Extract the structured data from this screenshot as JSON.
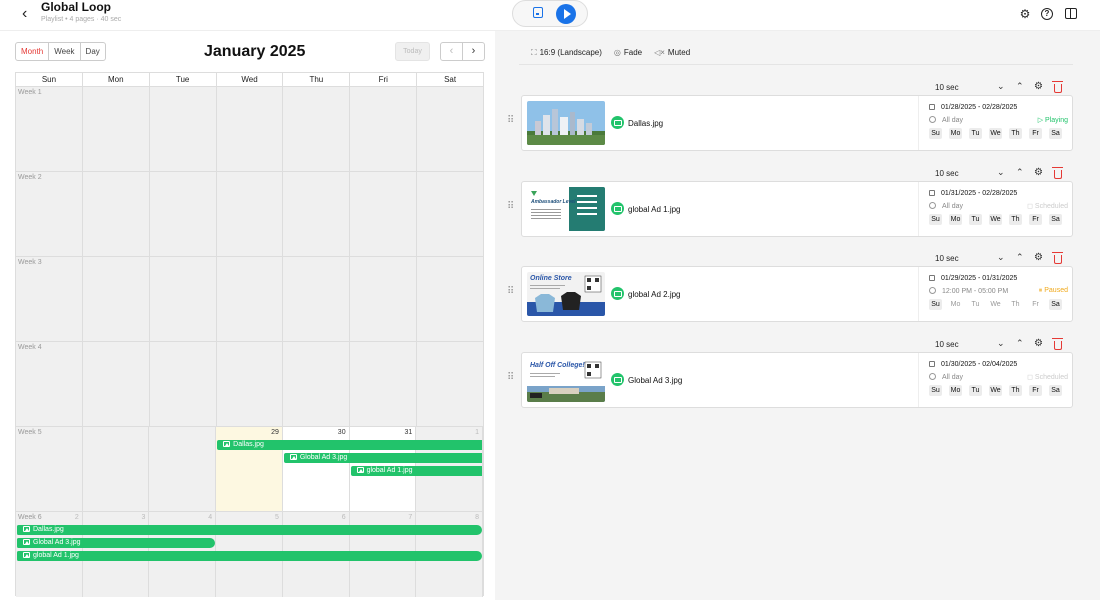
{
  "header": {
    "title": "Global Loop",
    "subtitle": "Playlist • 4 pages · 40 sec",
    "back_icon": "chevron-left-icon",
    "actions": [
      "save-icon",
      "play-icon"
    ],
    "right_icons": [
      "gear-icon",
      "help-icon",
      "layout-icon"
    ]
  },
  "calendar": {
    "views": [
      "Month",
      "Week",
      "Day"
    ],
    "active_view": "Month",
    "title": "January 2025",
    "today_label": "Today",
    "weekdays": [
      "Sun",
      "Mon",
      "Tue",
      "Wed",
      "Thu",
      "Fri",
      "Sat"
    ],
    "weeks": [
      {
        "label": "Week 1",
        "days": [
          {
            "d": "",
            "s": "blank"
          },
          {
            "d": "",
            "s": "blank"
          },
          {
            "d": "",
            "s": "blank"
          },
          {
            "d": "",
            "s": "blank"
          },
          {
            "d": "",
            "s": "blank"
          },
          {
            "d": "",
            "s": "blank"
          },
          {
            "d": "",
            "s": "blank"
          }
        ]
      },
      {
        "label": "Week 2",
        "days": [
          {
            "d": "",
            "s": "blank"
          },
          {
            "d": "",
            "s": "blank"
          },
          {
            "d": "",
            "s": "blank"
          },
          {
            "d": "",
            "s": "blank"
          },
          {
            "d": "",
            "s": "blank"
          },
          {
            "d": "",
            "s": "blank"
          },
          {
            "d": "",
            "s": "blank"
          }
        ]
      },
      {
        "label": "Week 3",
        "days": [
          {
            "d": "",
            "s": "blank"
          },
          {
            "d": "",
            "s": "blank"
          },
          {
            "d": "",
            "s": "blank"
          },
          {
            "d": "",
            "s": "blank"
          },
          {
            "d": "",
            "s": "blank"
          },
          {
            "d": "",
            "s": "blank"
          },
          {
            "d": "",
            "s": "blank"
          }
        ]
      },
      {
        "label": "Week 4",
        "days": [
          {
            "d": "",
            "s": "blank"
          },
          {
            "d": "",
            "s": "blank"
          },
          {
            "d": "",
            "s": "blank"
          },
          {
            "d": "",
            "s": "blank"
          },
          {
            "d": "",
            "s": "blank"
          },
          {
            "d": "",
            "s": "blank"
          },
          {
            "d": "",
            "s": "blank"
          }
        ]
      },
      {
        "label": "Week 5",
        "days": [
          {
            "d": "",
            "s": "blank"
          },
          {
            "d": "",
            "s": "blank"
          },
          {
            "d": "",
            "s": "blank"
          },
          {
            "d": "29",
            "s": "today"
          },
          {
            "d": "30",
            "s": "cur"
          },
          {
            "d": "31",
            "s": "cur"
          },
          {
            "d": "1",
            "s": "other"
          }
        ]
      },
      {
        "label": "Week 6",
        "days": [
          {
            "d": "2",
            "s": "other"
          },
          {
            "d": "3",
            "s": "other"
          },
          {
            "d": "4",
            "s": "other"
          },
          {
            "d": "5",
            "s": "other"
          },
          {
            "d": "6",
            "s": "other"
          },
          {
            "d": "7",
            "s": "other"
          },
          {
            "d": "8",
            "s": "other"
          }
        ]
      }
    ],
    "events": [
      {
        "week": 4,
        "start": 3,
        "end": 7,
        "lane": 0,
        "label": "Dallas.jpg"
      },
      {
        "week": 4,
        "start": 4,
        "end": 7,
        "lane": 1,
        "label": "Global Ad 3.jpg"
      },
      {
        "week": 4,
        "start": 5,
        "end": 7,
        "lane": 2,
        "label": "global Ad 1.jpg"
      },
      {
        "week": 5,
        "start": 0,
        "end": 7,
        "lane": 0,
        "label": "Dallas.jpg",
        "round_end": true
      },
      {
        "week": 5,
        "start": 0,
        "end": 3,
        "lane": 1,
        "label": "Global Ad 3.jpg",
        "round_end": true
      },
      {
        "week": 5,
        "start": 0,
        "end": 7,
        "lane": 2,
        "label": "global Ad 1.jpg",
        "round_end": true
      }
    ]
  },
  "options": {
    "aspect": "16:9 (Landscape)",
    "transition": "Fade",
    "audio": "Muted"
  },
  "playlist": [
    {
      "duration": "10 sec",
      "file": "Dallas.jpg",
      "dates": "01/28/2025 - 02/28/2025",
      "time": "All day",
      "status": "Playing",
      "status_kind": "playing",
      "days": [
        [
          "Su",
          true
        ],
        [
          "Mo",
          true
        ],
        [
          "Tu",
          true
        ],
        [
          "We",
          true
        ],
        [
          "Th",
          true
        ],
        [
          "Fr",
          true
        ],
        [
          "Sa",
          true
        ]
      ],
      "thumb": "city"
    },
    {
      "duration": "10 sec",
      "file": "global Ad 1.jpg",
      "dates": "01/31/2025 - 02/28/2025",
      "time": "All day",
      "status": "Scheduled",
      "status_kind": "scheduled",
      "days": [
        [
          "Su",
          true
        ],
        [
          "Mo",
          true
        ],
        [
          "Tu",
          true
        ],
        [
          "We",
          true
        ],
        [
          "Th",
          true
        ],
        [
          "Fr",
          true
        ],
        [
          "Sa",
          true
        ]
      ],
      "thumb": "ambassador",
      "thumb_text": "Ambassador Level"
    },
    {
      "duration": "10 sec",
      "file": "global Ad 2.jpg",
      "dates": "01/29/2025 - 01/31/2025",
      "time": "12:00 PM - 05:00 PM",
      "status": "Paused",
      "status_kind": "paused",
      "days": [
        [
          "Su",
          true
        ],
        [
          "Mo",
          false
        ],
        [
          "Tu",
          false
        ],
        [
          "We",
          false
        ],
        [
          "Th",
          false
        ],
        [
          "Fr",
          false
        ],
        [
          "Sa",
          true
        ]
      ],
      "thumb": "store",
      "thumb_text": "Online Store"
    },
    {
      "duration": "10 sec",
      "file": "Global Ad 3.jpg",
      "dates": "01/30/2025 - 02/04/2025",
      "time": "All day",
      "status": "Scheduled",
      "status_kind": "scheduled",
      "days": [
        [
          "Su",
          true
        ],
        [
          "Mo",
          true
        ],
        [
          "Tu",
          true
        ],
        [
          "We",
          true
        ],
        [
          "Th",
          true
        ],
        [
          "Fr",
          true
        ],
        [
          "Sa",
          true
        ]
      ],
      "thumb": "college",
      "thumb_text": "Half Off College!"
    }
  ],
  "colors": {
    "accent": "#1a73e8",
    "event": "#22c36b",
    "danger": "#e53935",
    "paused": "#f0a91b"
  }
}
